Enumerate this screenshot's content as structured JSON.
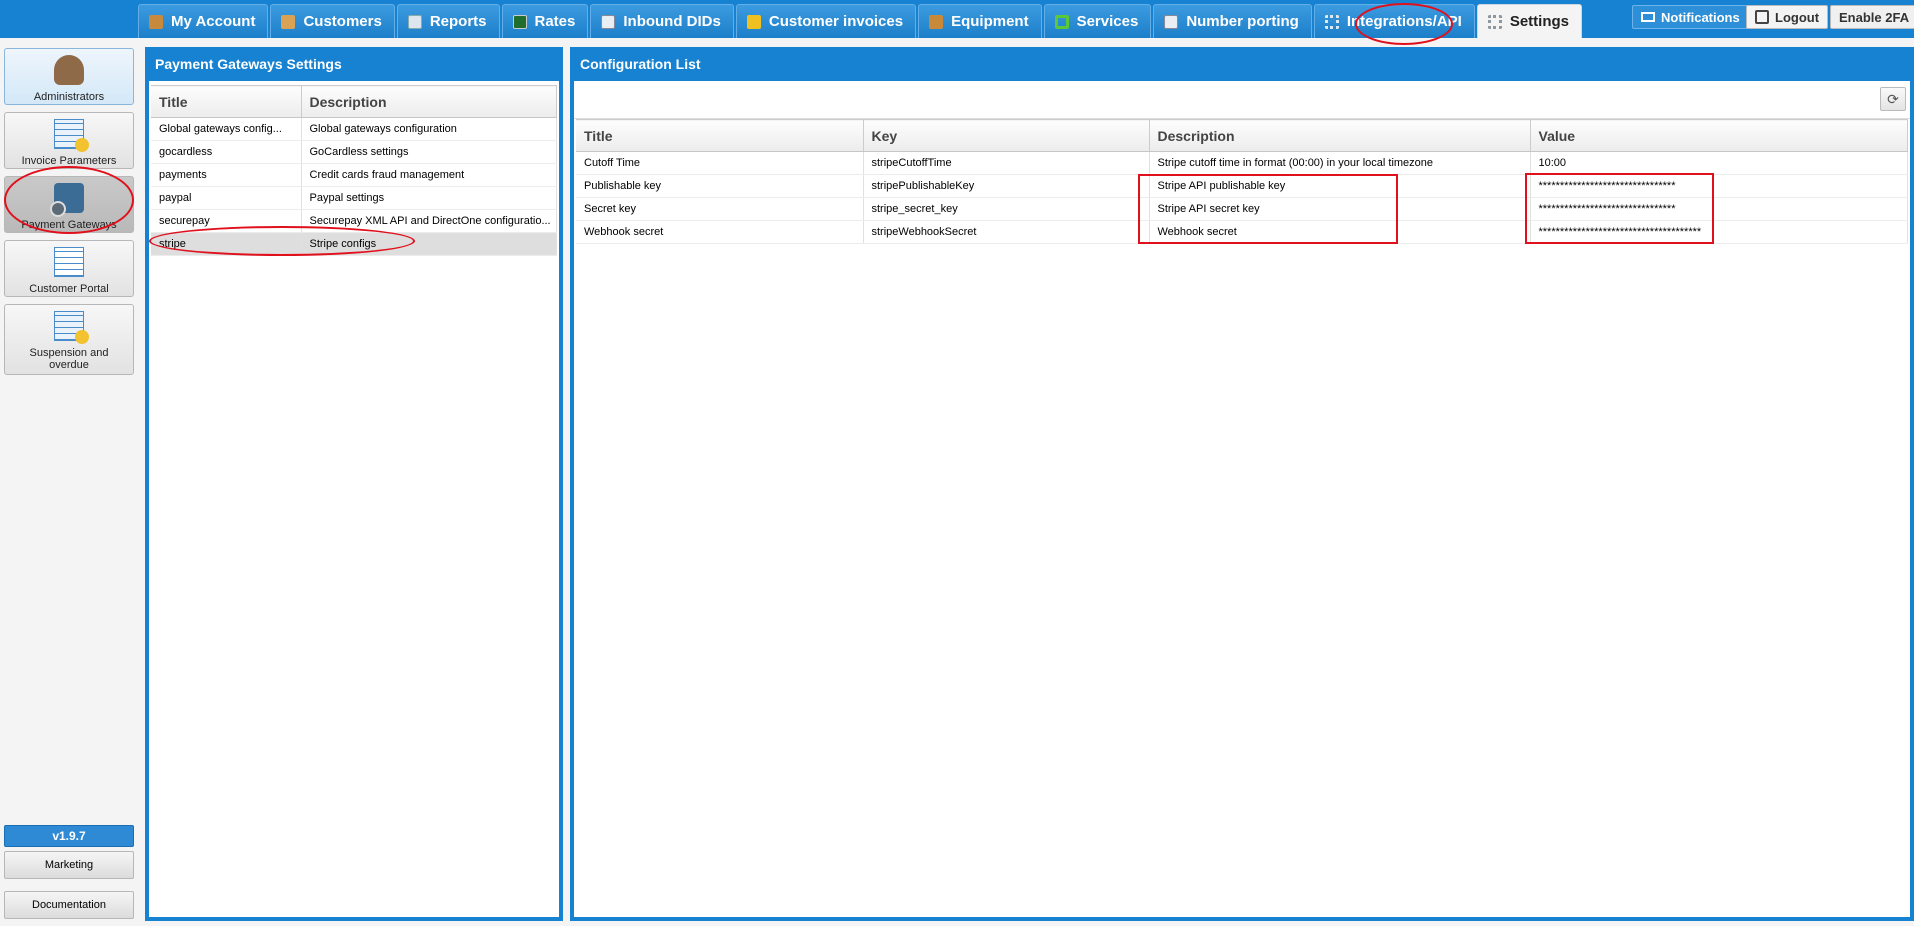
{
  "top_tabs": [
    {
      "label": "My Account"
    },
    {
      "label": "Customers"
    },
    {
      "label": "Reports"
    },
    {
      "label": "Rates"
    },
    {
      "label": "Inbound DIDs"
    },
    {
      "label": "Customer invoices"
    },
    {
      "label": "Equipment"
    },
    {
      "label": "Services"
    },
    {
      "label": "Number porting"
    },
    {
      "label": "Integrations/API"
    },
    {
      "label": "Settings"
    }
  ],
  "top_right": {
    "notifications": "Notifications",
    "logout": "Logout",
    "enable_2fa": "Enable 2FA"
  },
  "left_nav": [
    {
      "label": "Administrators"
    },
    {
      "label": "Invoice Parameters"
    },
    {
      "label": "Payment Gateways"
    },
    {
      "label": "Customer Portal"
    },
    {
      "label": "Suspension and overdue"
    }
  ],
  "bottom_nav": {
    "version": "v1.9.7",
    "marketing": "Marketing",
    "documentation": "Documentation"
  },
  "gateways_panel": {
    "title": "Payment Gateways Settings",
    "columns": [
      "Title",
      "Description"
    ],
    "rows": [
      [
        "Global gateways config...",
        "Global gateways configuration"
      ],
      [
        "gocardless",
        "GoCardless settings"
      ],
      [
        "payments",
        "Credit cards fraud management"
      ],
      [
        "paypal",
        "Paypal settings"
      ],
      [
        "securepay",
        "Securepay XML API and DirectOne configuratio..."
      ],
      [
        "stripe",
        "Stripe configs"
      ]
    ],
    "selected_row": 5
  },
  "config_panel": {
    "title": "Configuration List",
    "columns": [
      "Title",
      "Key",
      "Description",
      "Value"
    ],
    "rows": [
      [
        "Cutoff Time",
        "stripeCutoffTime",
        "Stripe cutoff time in format (00:00) in your local timezone",
        "10:00"
      ],
      [
        "Publishable key",
        "stripePublishableKey",
        "Stripe API publishable key",
        "********************************"
      ],
      [
        "Secret key",
        "stripe_secret_key",
        "Stripe API secret key",
        "********************************"
      ],
      [
        "Webhook secret",
        "stripeWebhookSecret",
        "Webhook secret",
        "**************************************"
      ]
    ]
  },
  "annotation_color": "#e0101c",
  "accent_color": "#1782d1"
}
